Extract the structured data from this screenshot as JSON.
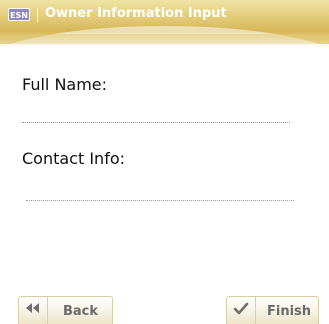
{
  "header": {
    "app_icon_text": "ESN",
    "title": "Owner Information Input"
  },
  "form": {
    "full_name_label": "Full Name:",
    "full_name_value": "",
    "contact_label": "Contact Info:",
    "contact_value": ""
  },
  "footer": {
    "back_label": "Back",
    "back_icon": "double-left-arrow-icon",
    "finish_label": "Finish",
    "finish_icon": "checkmark-icon"
  },
  "colors": {
    "title_bar": "#dcc060",
    "title_text": "#ffffff",
    "button_border": "#d8cfa4",
    "button_text": "#6a6a6a"
  }
}
